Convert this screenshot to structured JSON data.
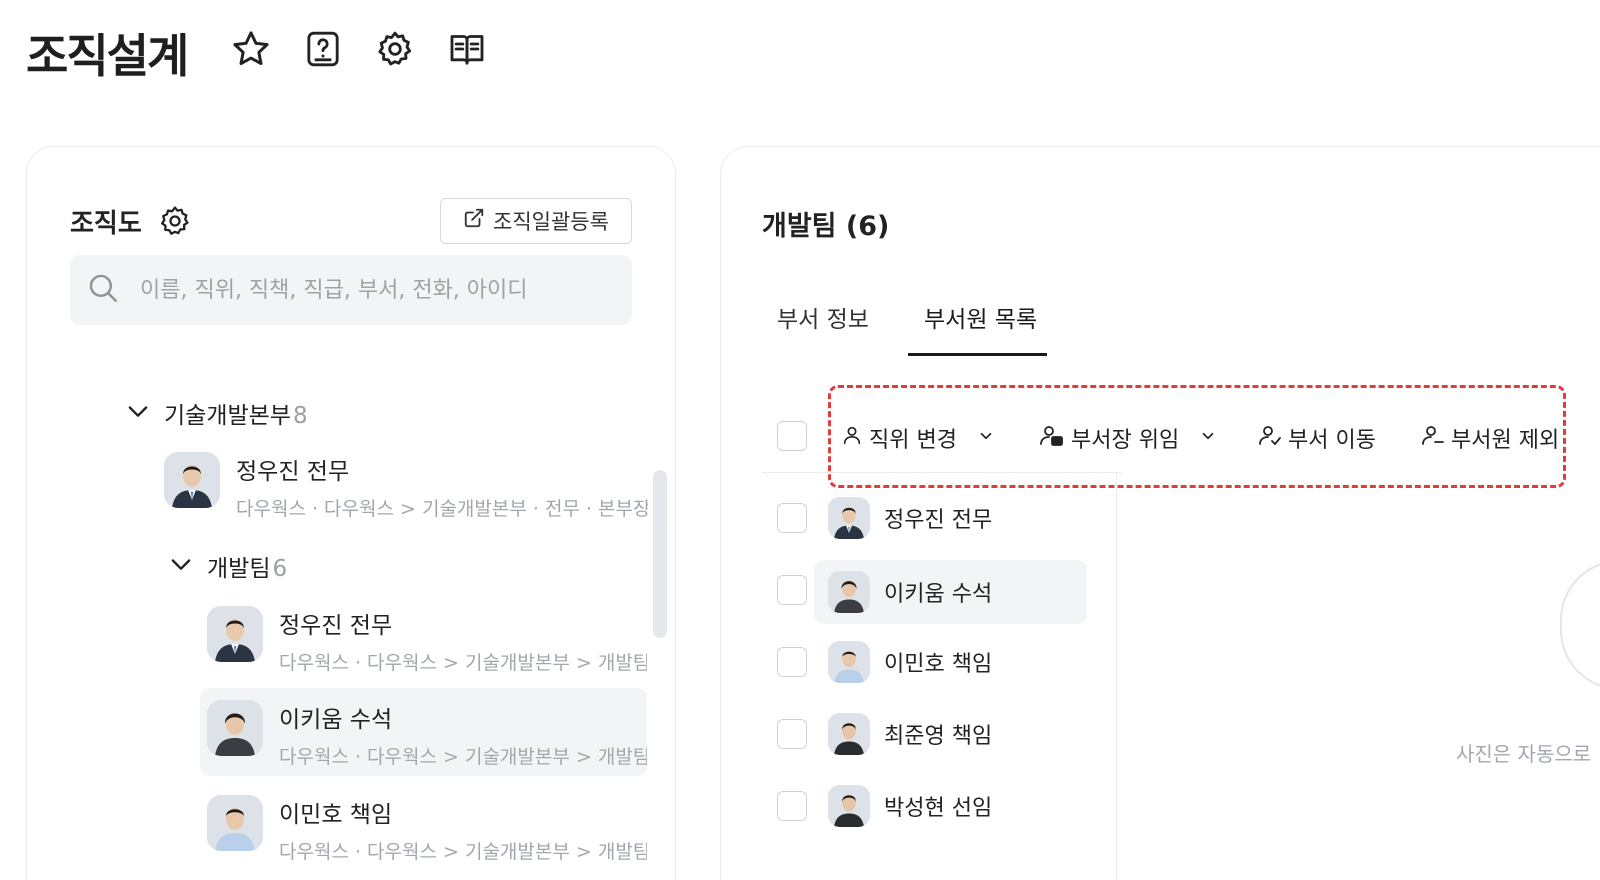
{
  "header": {
    "title": "조직설계",
    "icons": [
      "star-icon",
      "help-icon",
      "gear-icon",
      "book-icon"
    ]
  },
  "org_panel": {
    "title": "조직도",
    "bulk_register_label": "조직일괄등록",
    "search_placeholder": "이름, 직위, 직책, 직급, 부서, 전화, 아이디",
    "tree": {
      "division": {
        "label": "기술개발본부",
        "count": "8"
      },
      "division_head": {
        "name": "정우진 전무",
        "path": "다우웍스 · 다우웍스 > 기술개발본부 · 전무 · 본부장"
      },
      "team": {
        "label": "개발팀",
        "count": "6"
      },
      "members": [
        {
          "name": "정우진 전무",
          "path": "다우웍스 · 다우웍스 > 기술개발본부 > 개발팀"
        },
        {
          "name": "이키움 수석",
          "path": "다우웍스 · 다우웍스 > 기술개발본부 > 개발팀"
        },
        {
          "name": "이민호 책임",
          "path": "다우웍스 · 다우웍스 > 기술개발본부 > 개발팀"
        }
      ]
    }
  },
  "dept_panel": {
    "title": "개발팀 (6)",
    "tabs": [
      {
        "label": "부서 정보"
      },
      {
        "label": "부서원 목록"
      }
    ],
    "active_tab": "부서원 목록",
    "toolbar": {
      "change_position": "직위 변경",
      "delegate_head": "부서장 위임",
      "move_dept": "부서 이동",
      "remove_member": "부서원 제외"
    },
    "members": [
      {
        "name": "정우진 전무"
      },
      {
        "name": "이키움 수석"
      },
      {
        "name": "이민호 책임"
      },
      {
        "name": "최준영 책임"
      },
      {
        "name": "박성현 선임"
      }
    ],
    "photo_note": "사진은 자동으로"
  },
  "colors": {
    "accent_highlight": "#e23b3b",
    "selected_bg": "#f3f4f6"
  }
}
